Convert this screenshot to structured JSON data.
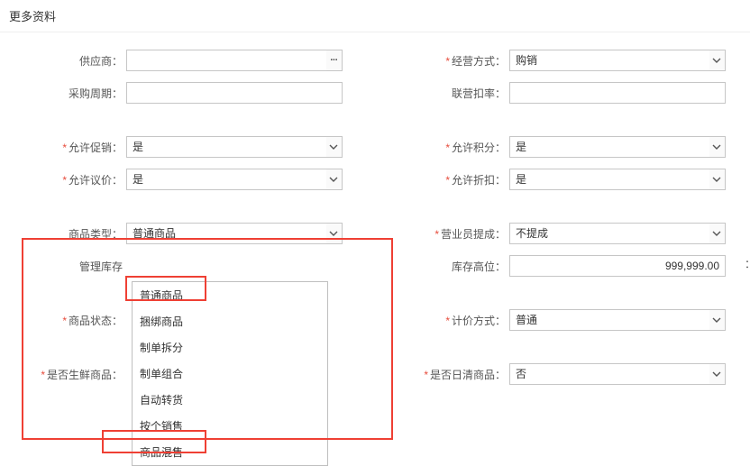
{
  "title": "更多资料",
  "left": {
    "supplier": {
      "label": "供应商：",
      "value": ""
    },
    "purchase_cycle": {
      "label": "采购周期：",
      "value": ""
    },
    "allow_promotion": {
      "label": "允许促销：",
      "value": "是",
      "required": true
    },
    "allow_bargain": {
      "label": "允许议价：",
      "value": "是",
      "required": true
    },
    "product_type": {
      "label": "商品类型：",
      "value": "普通商品"
    },
    "manage_stock": {
      "label": "管理库存"
    },
    "product_status": {
      "label": "商品状态：",
      "required": true
    },
    "is_fresh": {
      "label": "是否生鲜商品：",
      "value": "",
      "required": true
    }
  },
  "right": {
    "business_mode": {
      "label": "经营方式：",
      "value": "购销",
      "required": true
    },
    "joint_discount": {
      "label": "联营扣率：",
      "value": ""
    },
    "allow_points": {
      "label": "允许积分：",
      "value": "是",
      "required": true
    },
    "allow_discount": {
      "label": "允许折扣：",
      "value": "是",
      "required": true
    },
    "sales_commission": {
      "label": "营业员提成：",
      "value": "不提成",
      "required": true
    },
    "stock_high": {
      "label": "库存高位：",
      "value": "999,999.00"
    },
    "pricing_method": {
      "label": "计价方式：",
      "value": "普通",
      "required": true
    },
    "daily_clear": {
      "label": "是否日清商品：",
      "value": "否",
      "required": true
    }
  },
  "product_type_options": [
    "普通商品",
    "捆绑商品",
    "制单拆分",
    "制单组合",
    "自动转货",
    "按个销售",
    "商品混售"
  ],
  "lookup_glyph": "···",
  "right_edge": "："
}
